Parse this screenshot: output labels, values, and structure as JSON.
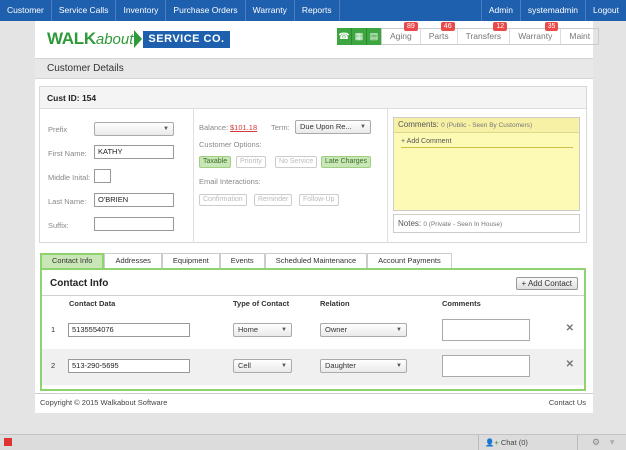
{
  "topnav": {
    "left": [
      "Customer",
      "Service Calls",
      "Inventory",
      "Purchase Orders",
      "Warranty",
      "Reports"
    ],
    "right": [
      "Admin",
      "systemadmin",
      "Logout"
    ]
  },
  "header": {
    "logo_walk": "WALK",
    "logo_about": "about",
    "logo_service": "SERVICE CO.",
    "status_tabs": [
      {
        "label": "Aging",
        "badge": "89"
      },
      {
        "label": "Parts",
        "badge": "46"
      },
      {
        "label": "Transfers",
        "badge": "12"
      },
      {
        "label": "Warranty",
        "badge": "35"
      },
      {
        "label": "Maint",
        "badge": ""
      }
    ]
  },
  "page_title": "Customer Details",
  "customer": {
    "id_label": "Cust ID: 154",
    "prefix_label": "Prefix",
    "prefix_value": "",
    "first_name_label": "First Name:",
    "first_name": "KATHY",
    "middle_label": "Middle Inital:",
    "middle": "",
    "last_name_label": "Last Name:",
    "last_name": "O'BRIEN",
    "suffix_label": "Suffix:",
    "suffix": ""
  },
  "account": {
    "balance_label": "Balance:",
    "balance": "$101.18",
    "term_label": "Term:",
    "term": "Due Upon Re...",
    "options_label": "Customer Options:",
    "options": [
      {
        "label": "Taxable",
        "on": true
      },
      {
        "label": "Priority",
        "on": false
      },
      {
        "label": "No Service",
        "on": false
      },
      {
        "label": "Late Charges",
        "on": true
      }
    ],
    "email_label": "Email Interactions:",
    "email_options": [
      {
        "label": "Confirmation",
        "on": false
      },
      {
        "label": "Reminder",
        "on": false
      },
      {
        "label": "Follow-Up",
        "on": false
      }
    ]
  },
  "comments": {
    "title": "Comments:",
    "subtitle": "0 (Public - Seen By Customers)",
    "add": "+ Add Comment",
    "notes_title": "Notes:",
    "notes_subtitle": "0 (Private - Seen In House)"
  },
  "tabs": [
    "Contact Info",
    "Addresses",
    "Equipment",
    "Events",
    "Scheduled Maintenance",
    "Account Payments"
  ],
  "contact": {
    "title": "Contact Info",
    "add_button": "+ Add Contact",
    "headers": {
      "data": "Contact Data",
      "type": "Type of Contact",
      "relation": "Relation",
      "comments": "Comments"
    },
    "rows": [
      {
        "num": "1",
        "data": "5135554076",
        "type": "Home",
        "relation": "Owner"
      },
      {
        "num": "2",
        "data": "513-290-5695",
        "type": "Cell",
        "relation": "Daughter"
      }
    ]
  },
  "footer": {
    "copyright": "Copyright © 2015 Walkabout Software",
    "contact": "Contact Us"
  },
  "bottombar": {
    "chat": "Chat (0)"
  }
}
